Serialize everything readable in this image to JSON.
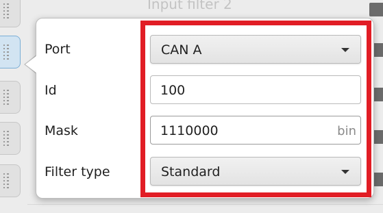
{
  "background": {
    "header_text": "Input filter 2"
  },
  "filter_popover": {
    "port": {
      "label": "Port",
      "value": "CAN A",
      "icon": "chevron-down-icon"
    },
    "id": {
      "label": "Id",
      "value": "100"
    },
    "mask": {
      "label": "Mask",
      "value": "1110000",
      "unit": "bin"
    },
    "filter_type": {
      "label": "Filter type",
      "value": "Standard",
      "icon": "chevron-down-icon"
    }
  },
  "colors": {
    "highlight": "#e11d25",
    "selected_handle": "#d2e4f2"
  }
}
